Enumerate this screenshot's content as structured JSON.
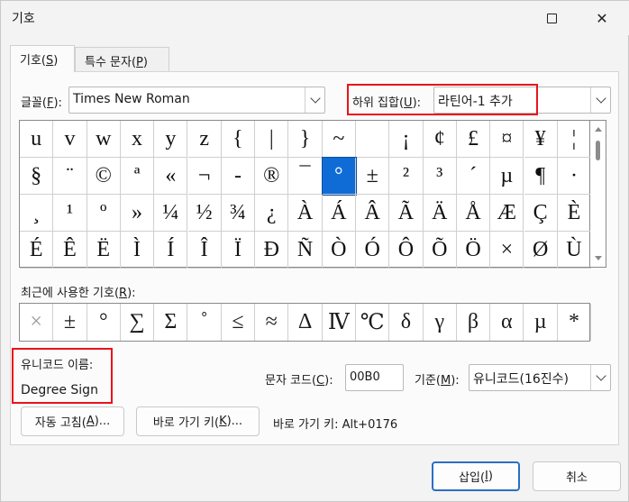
{
  "window": {
    "title": "기호"
  },
  "tabs": [
    {
      "label": "기호(",
      "key": "S",
      "suffix": ")"
    },
    {
      "label": "특수 문자(",
      "key": "P",
      "suffix": ")"
    }
  ],
  "font": {
    "label": "글꼴(",
    "key": "F",
    "suffix": "):",
    "value": "Times New Roman"
  },
  "subset": {
    "label": "하위 집합(",
    "key": "U",
    "suffix": "):",
    "value": "라틴어-1 추가"
  },
  "symbols": [
    [
      "u",
      "v",
      "w",
      "x",
      "y",
      "z",
      "{",
      "|",
      "}",
      "~",
      "",
      "¡",
      "¢",
      "£",
      "¤",
      "¥",
      "¦"
    ],
    [
      "§",
      "¨",
      "©",
      "ª",
      "«",
      "¬",
      "-",
      "®",
      "¯",
      "°",
      "±",
      "²",
      "³",
      "´",
      "µ",
      "¶",
      "·"
    ],
    [
      "¸",
      "¹",
      "º",
      "»",
      "¼",
      "½",
      "¾",
      "¿",
      "À",
      "Á",
      "Â",
      "Ã",
      "Ä",
      "Å",
      "Æ",
      "Ç",
      "È"
    ],
    [
      "É",
      "Ê",
      "Ë",
      "Ì",
      "Í",
      "Î",
      "Ï",
      "Ð",
      "Ñ",
      "Ò",
      "Ó",
      "Ô",
      "Õ",
      "Ö",
      "×",
      "Ø",
      "Ù"
    ]
  ],
  "recent": {
    "label": "최근에 사용한 기호(",
    "key": "R",
    "suffix": "):",
    "items": [
      "×",
      "±",
      "°",
      "∑",
      "Σ",
      "˚",
      "≤",
      "≈",
      "Δ",
      "Ⅳ",
      "℃",
      "δ",
      "γ",
      "β",
      "α",
      "µ",
      "*"
    ]
  },
  "unicode_name": {
    "label": "유니코드 이름:",
    "value": "Degree Sign"
  },
  "char_code": {
    "label": "문자 코드(",
    "key": "C",
    "suffix": "):",
    "value": "00B0"
  },
  "from": {
    "label": "기준(",
    "key": "M",
    "suffix": "):",
    "value": "유니코드(16진수)"
  },
  "buttons": {
    "autocorrect": {
      "label": "자동 고침(",
      "key": "A",
      "suffix": ")..."
    },
    "shortcut": {
      "label": "바로 가기 키(",
      "key": "K",
      "suffix": ")..."
    },
    "shortcut_text": "바로 가기 키: Alt+0176",
    "insert": {
      "label": "삽입(",
      "key": "I",
      "suffix": ")"
    },
    "cancel": "취소"
  },
  "colors": {
    "selection": "#0f6cd6",
    "highlight": "#e8141b"
  }
}
